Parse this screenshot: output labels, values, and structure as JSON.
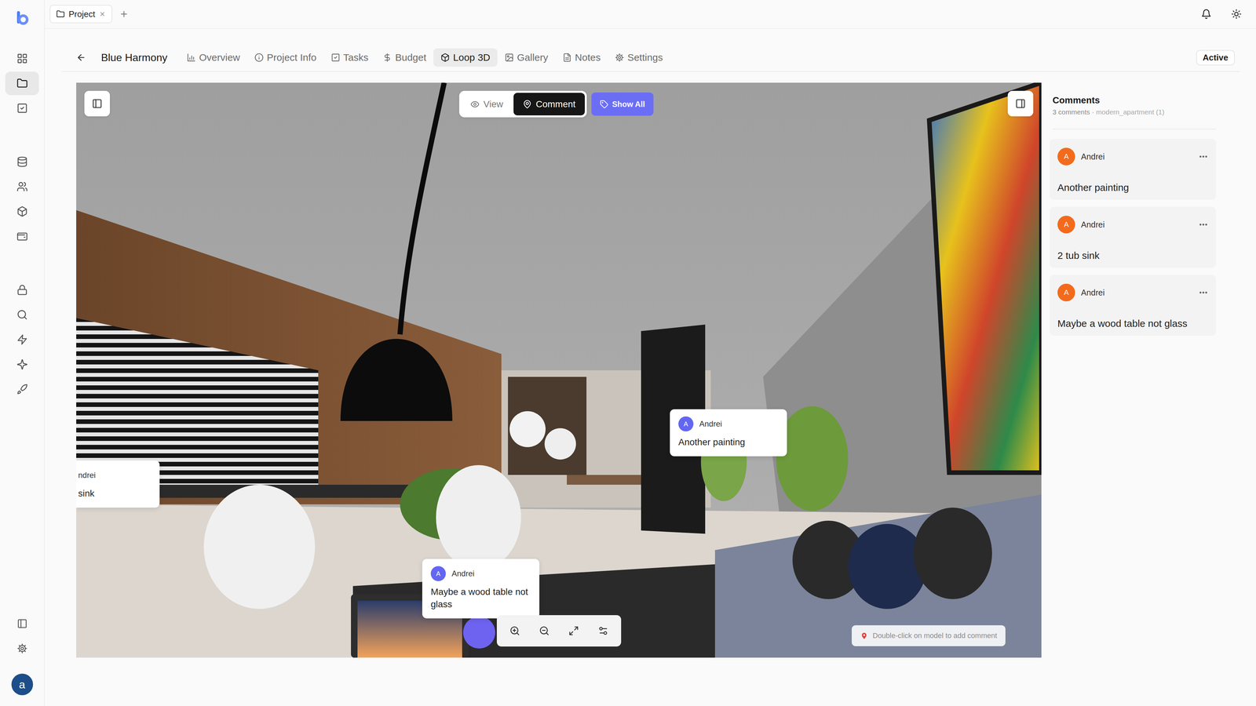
{
  "rail": {
    "groups": [
      [
        {
          "selected": false
        },
        {
          "selected": true
        },
        {
          "selected": false
        }
      ],
      [
        {
          "selected": false
        },
        {
          "selected": false
        },
        {
          "selected": false
        },
        {
          "selected": false
        }
      ],
      [
        {
          "selected": false
        },
        {
          "selected": false
        },
        {
          "selected": false
        },
        {
          "selected": false
        },
        {
          "selected": false
        }
      ]
    ],
    "user": {
      "initial": "a"
    }
  },
  "tabs": [
    {
      "label": "Project",
      "selected": true
    }
  ],
  "project": {
    "title": "Blue Harmony",
    "status": "Active"
  },
  "nav": [
    {
      "label": "Overview",
      "selected": false
    },
    {
      "label": "Project Info",
      "selected": false
    },
    {
      "label": "Tasks",
      "selected": false
    },
    {
      "label": "Budget",
      "selected": false
    },
    {
      "label": "Loop 3D",
      "selected": true
    },
    {
      "label": "Gallery",
      "selected": false
    },
    {
      "label": "Notes",
      "selected": false
    },
    {
      "label": "Settings",
      "selected": false
    }
  ],
  "viewer": {
    "modes": [
      {
        "label": "View",
        "selected": false
      },
      {
        "label": "Comment",
        "selected": true
      }
    ],
    "show_all": {
      "label": "Show All",
      "on": true
    },
    "hint": "Double-click on model to add comment",
    "pins": [
      {
        "author": "Andrei",
        "avatar": "A",
        "text": "Another painting",
        "clipped": false
      },
      {
        "author": "ndrei",
        "text": "sink",
        "clipped": true
      },
      {
        "author": "Andrei",
        "avatar": "A",
        "text": "Maybe a wood table not glass",
        "clipped": false
      }
    ]
  },
  "comments": {
    "title": "Comments",
    "count": "3 comments",
    "separator": "·",
    "model": "modern_apartment (1)",
    "items": [
      {
        "author": "Andrei",
        "avatar": "A",
        "text": "Another painting"
      },
      {
        "author": "Andrei",
        "avatar": "A",
        "text": "2 tub sink"
      },
      {
        "author": "Andrei",
        "avatar": "A",
        "text": "Maybe a wood table not glass"
      }
    ]
  }
}
